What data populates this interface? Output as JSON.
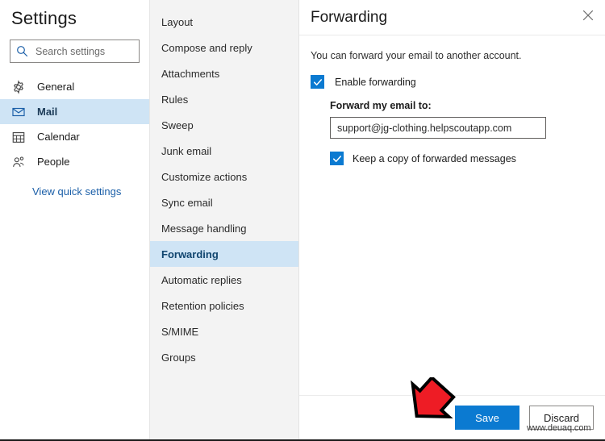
{
  "sidebar": {
    "title": "Settings",
    "search": {
      "placeholder": "Search settings",
      "value": "",
      "icon": "search-icon"
    },
    "items": [
      {
        "label": "General",
        "icon": "gear-icon",
        "selected": false
      },
      {
        "label": "Mail",
        "icon": "envelope-icon",
        "selected": true
      },
      {
        "label": "Calendar",
        "icon": "calendar-icon",
        "selected": false
      },
      {
        "label": "People",
        "icon": "people-icon",
        "selected": false
      }
    ],
    "quick_link": "View quick settings"
  },
  "subnav": {
    "items": [
      {
        "label": "Layout",
        "selected": false
      },
      {
        "label": "Compose and reply",
        "selected": false
      },
      {
        "label": "Attachments",
        "selected": false
      },
      {
        "label": "Rules",
        "selected": false
      },
      {
        "label": "Sweep",
        "selected": false
      },
      {
        "label": "Junk email",
        "selected": false
      },
      {
        "label": "Customize actions",
        "selected": false
      },
      {
        "label": "Sync email",
        "selected": false
      },
      {
        "label": "Message handling",
        "selected": false
      },
      {
        "label": "Forwarding",
        "selected": true
      },
      {
        "label": "Automatic replies",
        "selected": false
      },
      {
        "label": "Retention policies",
        "selected": false
      },
      {
        "label": "S/MIME",
        "selected": false
      },
      {
        "label": "Groups",
        "selected": false
      }
    ]
  },
  "panel": {
    "title": "Forwarding",
    "close_icon": "close-icon",
    "description": "You can forward your email to another account.",
    "enable_forwarding": {
      "label": "Enable forwarding",
      "checked": true
    },
    "forward_to": {
      "label": "Forward my email to:",
      "value": "support@jg-clothing.helpscoutapp.com",
      "placeholder": ""
    },
    "keep_copy": {
      "label": "Keep a copy of forwarded messages",
      "checked": true
    },
    "footer": {
      "save_label": "Save",
      "discard_label": "Discard"
    }
  },
  "annotation": {
    "arrow": "red-arrow-pointing-to-save",
    "arrow_color": "#EE1C25",
    "arrow_outline_color": "#000000"
  },
  "watermark": {
    "text": "www.deuaq.com"
  },
  "colors": {
    "accent": "#0b7ad1",
    "selection_bg": "#cfe4f5",
    "subnav_bg": "#f3f3f3",
    "link": "#1b5fa8",
    "panel_bg": "#ffffff"
  }
}
